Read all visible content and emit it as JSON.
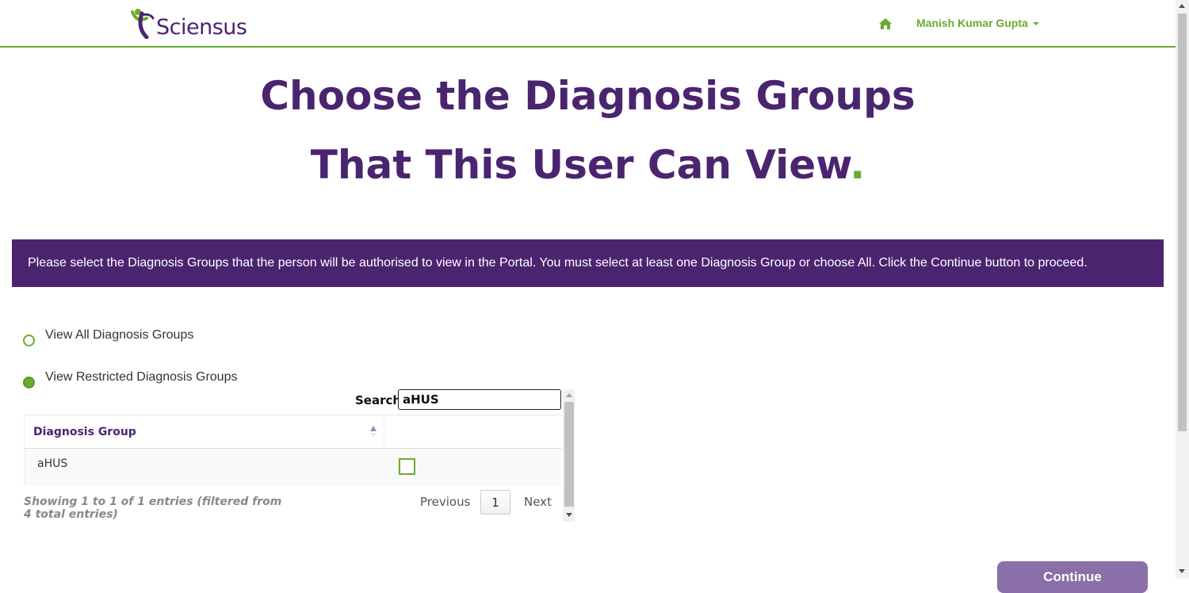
{
  "header": {
    "logo_text": "Sciensus",
    "home_icon": "home-icon",
    "user_name": "Manish Kumar Gupta"
  },
  "colors": {
    "brand_purple": "#4b2470",
    "brand_green": "#6aab2e",
    "button_disabled": "#8a6fa8"
  },
  "title": {
    "line1": "Choose the Diagnosis Groups",
    "line2": "That This User Can View",
    "dot": "."
  },
  "info_banner": "Please select the Diagnosis Groups that the person will be authorised to view in the Portal. You must select at least one Diagnosis Group or choose All. Click the Continue button to proceed.",
  "options": [
    {
      "label": "View All Diagnosis Groups",
      "selected": false
    },
    {
      "label": "View Restricted Diagnosis Groups",
      "selected": true
    }
  ],
  "search": {
    "label": "Search:",
    "value": "aHUS"
  },
  "table": {
    "columns": [
      "Diagnosis Group",
      ""
    ],
    "rows": [
      {
        "name": "aHUS",
        "checked": false
      }
    ],
    "info": "Showing 1 to 1 of 1 entries (filtered from 4 total entries)"
  },
  "pagination": {
    "previous": "Previous",
    "current_page": "1",
    "next": "Next"
  },
  "continue_button": "Continue"
}
